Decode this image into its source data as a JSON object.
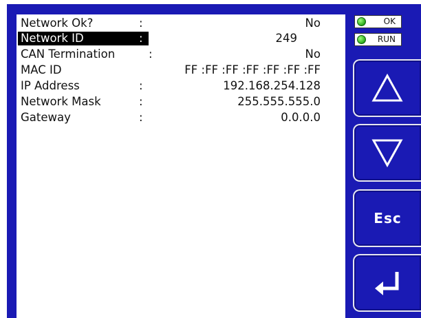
{
  "rows": [
    {
      "label": "Network Ok?",
      "colon": ":",
      "value": "No",
      "selected": false
    },
    {
      "label": "Network ID",
      "colon": ":",
      "value": "249",
      "selected": true
    },
    {
      "label": "CAN Termination",
      "colon": ":",
      "value": "No",
      "selected": false
    },
    {
      "label": "MAC ID",
      "colon": "",
      "value": "FF :FF :FF :FF :FF :FF :FF",
      "selected": false
    },
    {
      "label": "IP Address",
      "colon": ":",
      "value": "192.168.254.128",
      "selected": false
    },
    {
      "label": "Network Mask",
      "colon": ":",
      "value": "255.555.555.0",
      "selected": false
    },
    {
      "label": "Gateway",
      "colon": ":",
      "value": "0.0.0.0",
      "selected": false
    }
  ],
  "indicators": {
    "ok_label": "OK",
    "run_label": "RUN",
    "led_color": "#2aa81a"
  },
  "buttons": {
    "up_icon": "up-arrow-icon",
    "down_icon": "down-arrow-icon",
    "esc_label": "Esc",
    "enter_icon": "enter-icon"
  },
  "colors": {
    "frame": "#1a1ab4",
    "screen": "#ffffff",
    "highlight": "#000000"
  }
}
